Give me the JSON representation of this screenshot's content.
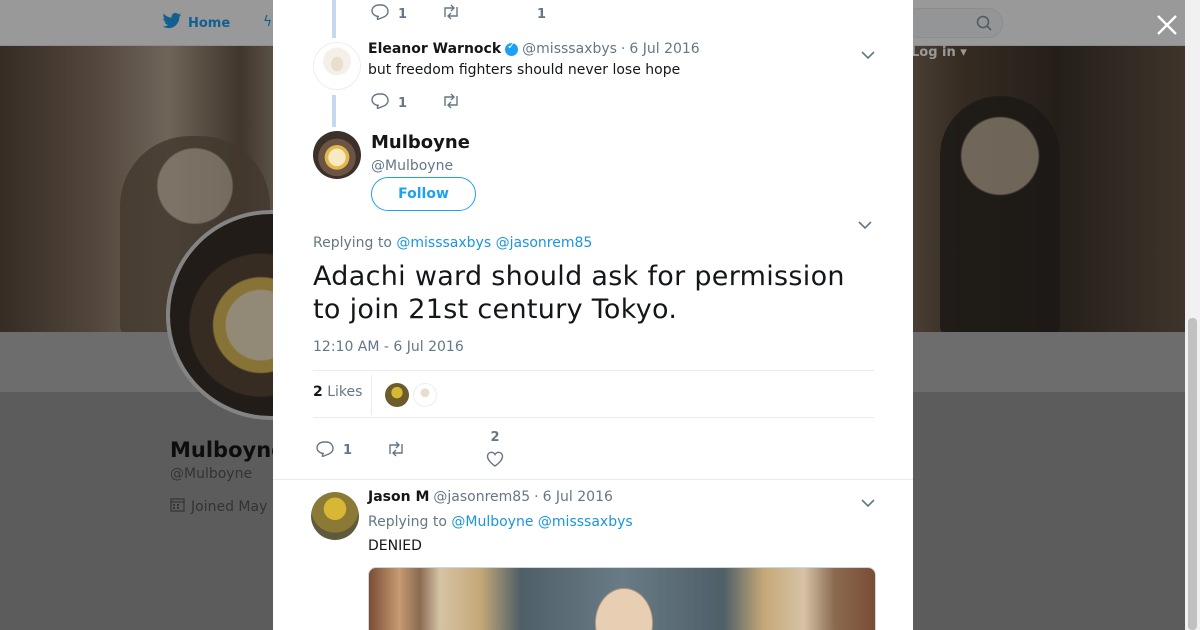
{
  "nav": {
    "home_label": "Home",
    "login_label": "Log in ▾"
  },
  "profile": {
    "name": "Mulboyne",
    "handle": "@Mulboyne",
    "joined": "Joined May"
  },
  "modal": {
    "prev_tweet_actions": {
      "replies": "1",
      "likes": "1"
    },
    "eleanor_tweet": {
      "name": "Eleanor Warnock",
      "handle": "@misssaxbys",
      "date": "6 Jul 2016",
      "text": "but freedom fighters should never lose hope",
      "replies": "1"
    },
    "main_tweet": {
      "name": "Mulboyne",
      "handle": "@Mulboyne",
      "follow_label": "Follow",
      "replying_label": "Replying to",
      "mentions": [
        "@misssaxbys",
        "@jasonrem85"
      ],
      "text": "Adachi ward should ask for permission to join 21st century Tokyo.",
      "timestamp": "12:10 AM - 6 Jul 2016",
      "likes_count": "2",
      "likes_label": "Likes",
      "replies": "1",
      "likes": "2"
    },
    "jason_tweet": {
      "name": "Jason M",
      "handle": "@jasonrem85",
      "date": "6 Jul 2016",
      "replying_label": "Replying to",
      "mentions": [
        "@Mulboyne",
        "@misssaxbys"
      ],
      "text": "DENIED"
    }
  },
  "icons": {
    "close": "close-icon",
    "reply": "reply-icon",
    "retweet": "retweet-icon",
    "like": "heart-icon",
    "caret": "chevron-down-icon",
    "verified": "verified-badge-icon",
    "twitter": "twitter-bird-icon",
    "calendar": "calendar-icon",
    "search": "search-icon"
  },
  "colors": {
    "accent": "#1da1f2",
    "mention": "#1b95e0",
    "muted": "#657786",
    "thread": "#c4d9ee"
  }
}
